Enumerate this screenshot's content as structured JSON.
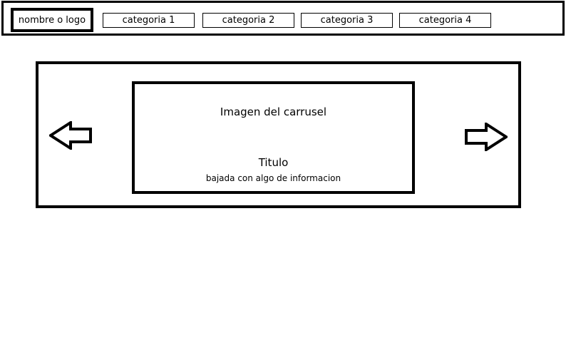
{
  "header": {
    "logo_label": "nombre o logo",
    "nav": [
      {
        "label": "categoria 1"
      },
      {
        "label": "categoria 2"
      },
      {
        "label": "categoria 3"
      },
      {
        "label": "categoria 4"
      }
    ]
  },
  "carousel": {
    "image_label": "Imagen del carrusel",
    "title": "Titulo",
    "subtitle": "bajada con algo de informacion",
    "prev_icon": "arrow-left-icon",
    "next_icon": "arrow-right-icon"
  }
}
